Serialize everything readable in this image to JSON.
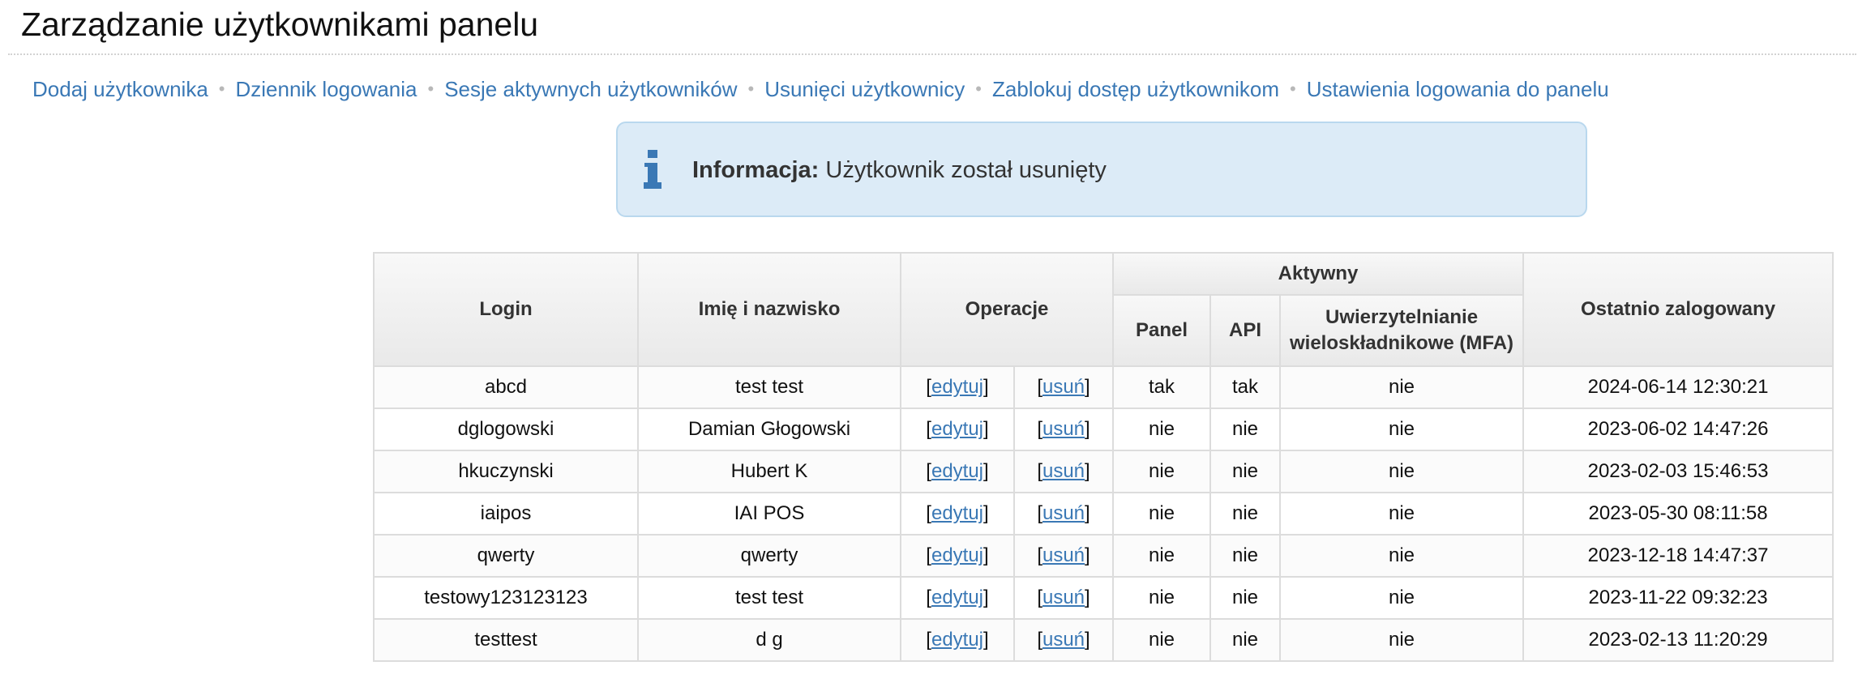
{
  "page": {
    "title": "Zarządzanie użytkownikami panelu"
  },
  "nav": {
    "items": [
      {
        "label": "Dodaj użytkownika"
      },
      {
        "label": "Dziennik logowania"
      },
      {
        "label": "Sesje aktywnych użytkowników"
      },
      {
        "label": "Usunięci użytkownicy"
      },
      {
        "label": "Zablokuj dostęp użytkownikom"
      },
      {
        "label": "Ustawienia logowania do panelu"
      }
    ],
    "separator": "•"
  },
  "info": {
    "icon": "info-icon",
    "label": "Informacja:",
    "message": "Użytkownik został usunięty",
    "colors": {
      "background": "#dcebf7",
      "border": "#b9d8ee",
      "icon": "#3a78b5"
    }
  },
  "table": {
    "headers": {
      "login": "Login",
      "name": "Imię i nazwisko",
      "operations": "Operacje",
      "active": "Aktywny",
      "panel": "Panel",
      "api": "API",
      "mfa": "Uwierzytelnianie wieloskładnikowe (MFA)",
      "last_login": "Ostatnio zalogowany"
    },
    "edit_label": "edytuj",
    "delete_label": "usuń",
    "rows": [
      {
        "login": "abcd",
        "name": "test test",
        "panel": "tak",
        "api": "tak",
        "mfa": "nie",
        "last_login": "2024-06-14 12:30:21"
      },
      {
        "login": "dglogowski",
        "name": "Damian Głogowski",
        "panel": "nie",
        "api": "nie",
        "mfa": "nie",
        "last_login": "2023-06-02 14:47:26"
      },
      {
        "login": "hkuczynski",
        "name": "Hubert K",
        "panel": "nie",
        "api": "nie",
        "mfa": "nie",
        "last_login": "2023-02-03 15:46:53"
      },
      {
        "login": "iaipos",
        "name": "IAI POS",
        "panel": "nie",
        "api": "nie",
        "mfa": "nie",
        "last_login": "2023-05-30 08:11:58"
      },
      {
        "login": "qwerty",
        "name": "qwerty",
        "panel": "nie",
        "api": "nie",
        "mfa": "nie",
        "last_login": "2023-12-18 14:47:37"
      },
      {
        "login": "testowy123123123",
        "name": "test test",
        "panel": "nie",
        "api": "nie",
        "mfa": "nie",
        "last_login": "2023-11-22 09:32:23"
      },
      {
        "login": "testtest",
        "name": "d g",
        "panel": "nie",
        "api": "nie",
        "mfa": "nie",
        "last_login": "2023-02-13 11:20:29"
      }
    ],
    "colors": {
      "yes": "#3c8c3c",
      "no": "#d4472e",
      "link": "#3a78b5"
    }
  }
}
